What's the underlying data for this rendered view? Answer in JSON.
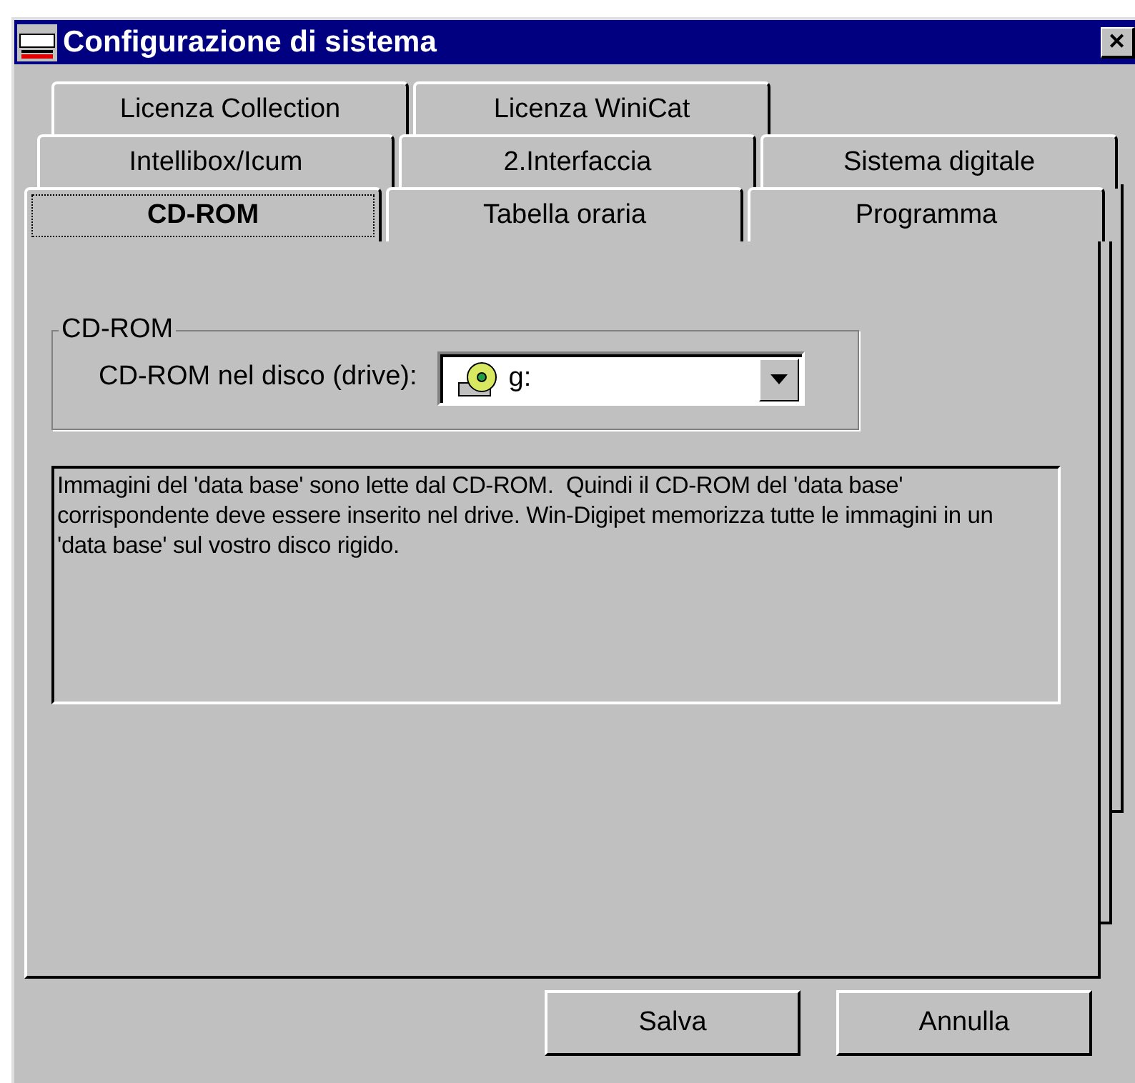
{
  "window": {
    "title": "Configurazione di sistema",
    "close": "✕"
  },
  "tab_rows": [
    [
      {
        "label": "Licenza Collection",
        "selected": false
      },
      {
        "label": "Licenza WiniCat",
        "selected": false
      }
    ],
    [
      {
        "label": "Intellibox/Icum",
        "selected": false
      },
      {
        "label": "2.Interfaccia",
        "selected": false
      },
      {
        "label": "Sistema digitale",
        "selected": false
      }
    ],
    [
      {
        "label": "CD-ROM",
        "selected": true
      },
      {
        "label": "Tabella oraria",
        "selected": false
      },
      {
        "label": "Programma",
        "selected": false
      }
    ]
  ],
  "group": {
    "title": "CD-ROM",
    "field_label": "CD-ROM nel disco (drive):",
    "drive": {
      "value": "g:"
    }
  },
  "info_text": "Immagini del 'data base' sono lette dal CD-ROM.  Quindi il CD-ROM del 'data base' corrispondente deve essere inserito nel drive. Win-Digipet memorizza tutte le immagini in un 'data base' sul vostro disco rigido.",
  "buttons": [
    {
      "label": "Salva"
    },
    {
      "label": "Annulla"
    }
  ]
}
